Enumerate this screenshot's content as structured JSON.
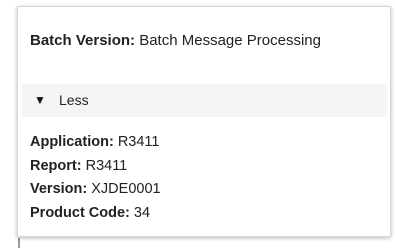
{
  "batch": {
    "label": "Batch Version:",
    "value": "Batch Message Processing"
  },
  "toggle": {
    "icon": "triangle-down-icon",
    "label": "Less"
  },
  "details": [
    {
      "label": "Application:",
      "value": "R3411"
    },
    {
      "label": "Report:",
      "value": "R3411"
    },
    {
      "label": "Version:",
      "value": "XJDE0001"
    },
    {
      "label": "Product Code:",
      "value": "34"
    }
  ]
}
